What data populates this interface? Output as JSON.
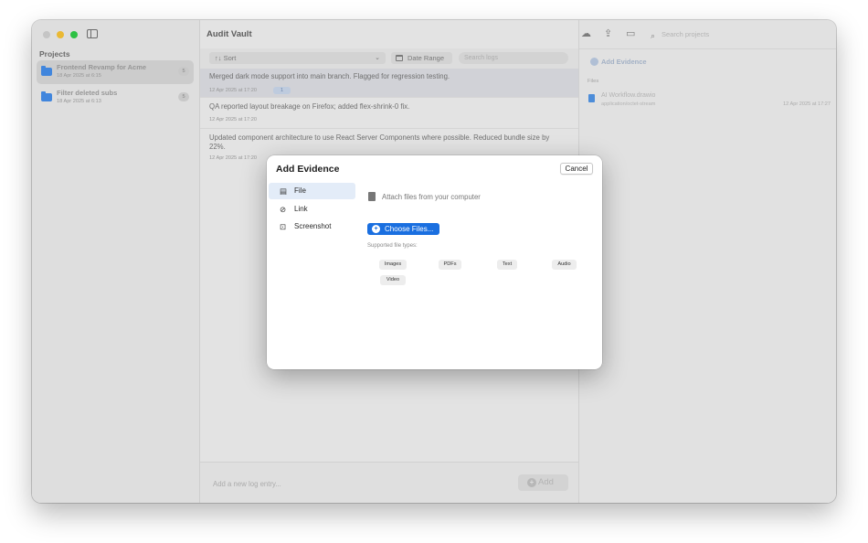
{
  "sidebar": {
    "heading": "Projects",
    "projects": [
      {
        "name": "Frontend Revamp for Acme",
        "date": "18 Apr 2025 at 6:15",
        "count": "5"
      },
      {
        "name": "Filter deleted subs",
        "date": "18 Apr 2025 at 6:13",
        "count": "5"
      }
    ]
  },
  "center": {
    "title": "Audit Vault",
    "sort_label": "↑↓ Sort",
    "sort_chevron": "⌄",
    "date_range_label": "Date Range",
    "search_placeholder": "Search logs",
    "logs": [
      {
        "message": "Merged dark mode support into main branch. Flagged for regression testing.",
        "timestamp": "12 Apr 2025 at 17:20",
        "attachments": "1"
      },
      {
        "message": "QA reported layout breakage on Firefox; added flex-shrink-0 fix.",
        "timestamp": "12 Apr 2025 at 17:20"
      },
      {
        "message": "Updated component architecture to use React Server Components where possible. Reduced bundle size by 22%.",
        "timestamp": "12 Apr 2025 at 17:20"
      }
    ],
    "composer_placeholder": "Add a new log entry...",
    "add_label": "Add",
    "add_symbol": "+"
  },
  "right": {
    "toolbar_icons": [
      "cloud-icon",
      "share-icon",
      "folder-badge-icon"
    ],
    "search_placeholder": "Search projects",
    "add_evidence_label": "Add Evidence",
    "files_label": "Files",
    "files": [
      {
        "name": "AI Workflow.drawio",
        "type": "application/octet-stream",
        "date": "12 Apr 2025 at 17:27"
      }
    ]
  },
  "modal": {
    "title": "Add Evidence",
    "cancel_label": "Cancel",
    "nav": [
      {
        "label": "File",
        "icon": "▤",
        "selected": true
      },
      {
        "label": "Link",
        "icon": "⊘"
      },
      {
        "label": "Screenshot",
        "icon": "⊡"
      }
    ],
    "attach_text": "Attach files from your computer",
    "choose_label": "Choose Files...",
    "choose_symbol": "+",
    "supported_label": "Supported file types:",
    "file_types": [
      "Images",
      "PDFs",
      "Text",
      "Audio",
      "Video"
    ]
  },
  "colors": {
    "accent": "#1a6fe0",
    "folder": "#3d88e6",
    "selected_nav": "#e3ecf8"
  }
}
